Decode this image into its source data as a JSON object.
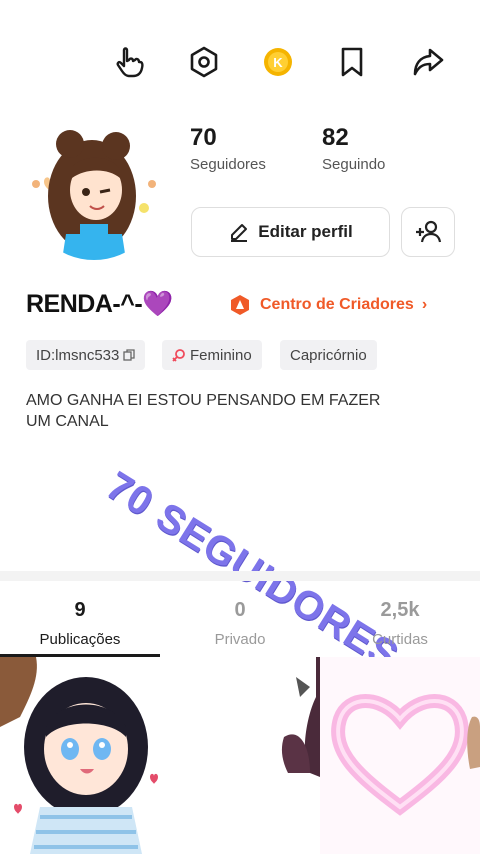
{
  "topbar": {
    "icons": [
      "hand-pointer-icon",
      "hexagon-settings-icon",
      "coin-icon",
      "bookmark-icon",
      "share-icon"
    ],
    "coin_letter": "K"
  },
  "stats": {
    "followers_count": "70",
    "followers_label": "Seguidores",
    "following_count": "82",
    "following_label": "Seguindo"
  },
  "actions": {
    "edit_label": "Editar perfil"
  },
  "profile": {
    "username": "RENDA-^-",
    "heart": "💜",
    "creator_center": "Centro de Criadores",
    "creator_chevron": "›",
    "tags": [
      "ID:lmsnc533",
      "Feminino",
      "Capricórnio"
    ],
    "bio": "AMO GANHA EI ESTOU PENSANDO EM FAZER UM CANAL"
  },
  "overlay": {
    "watermark": "70 SEGUIDORES"
  },
  "tabs": [
    {
      "count": "9",
      "label": "Publicações"
    },
    {
      "count": "0",
      "label": "Privado"
    },
    {
      "count": "2,5k",
      "label": "Curtidas"
    }
  ],
  "colors": {
    "creator_accent": "#f05a28",
    "watermark": "#6f66e8",
    "coin": "#f5b400"
  }
}
